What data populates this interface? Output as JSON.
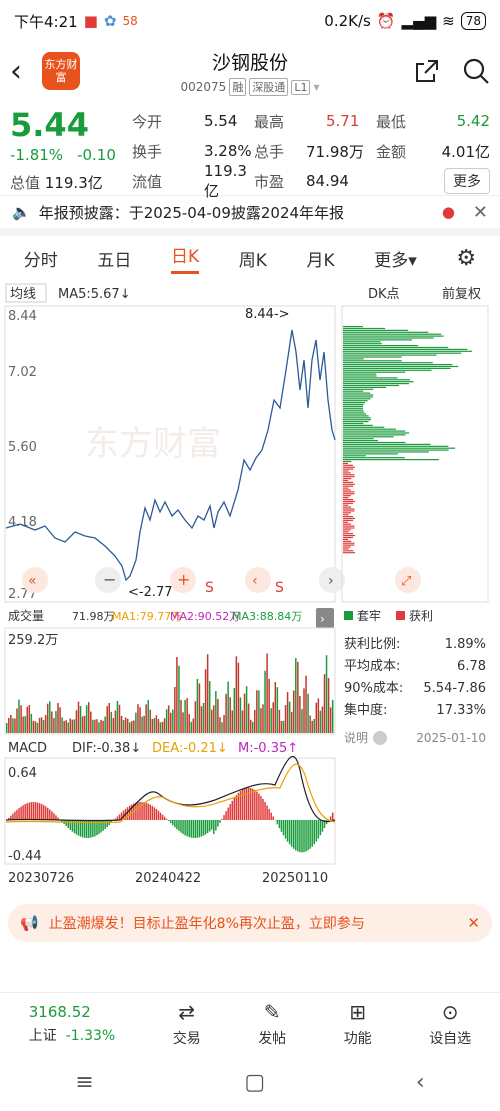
{
  "status": {
    "time": "下午4:21",
    "speed": "0.2K/s",
    "battery": "78",
    "app58": "58"
  },
  "header": {
    "logo": "东方财富",
    "title": "沙钢股份",
    "code": "002075",
    "tags": [
      "融",
      "深股通",
      "L1"
    ]
  },
  "quote": {
    "price": "5.44",
    "pct": "-1.81%",
    "chg": "-0.10",
    "rows": [
      [
        {
          "k": "今开",
          "v": "5.54",
          "c": ""
        },
        {
          "k": "最高",
          "v": "5.71",
          "c": "red"
        },
        {
          "k": "最低",
          "v": "5.42",
          "c": "green"
        }
      ],
      [
        {
          "k": "换手",
          "v": "3.28%",
          "c": ""
        },
        {
          "k": "总手",
          "v": "71.98万",
          "c": ""
        },
        {
          "k": "金额",
          "v": "4.01亿",
          "c": ""
        }
      ],
      [
        {
          "k": "总值",
          "v": "119.3亿",
          "c": ""
        },
        {
          "k": "流值",
          "v": "119.3亿",
          "c": ""
        },
        {
          "k": "市盈",
          "v": "84.94",
          "c": ""
        }
      ]
    ],
    "more": "更多"
  },
  "notice": {
    "text": "年报预披露：于2025-04-09披露2024年年报"
  },
  "tabs": [
    "分时",
    "五日",
    "日K",
    "周K",
    "月K",
    "更多"
  ],
  "chart": {
    "mode": "均线",
    "ma5": "MA5:5.67↓",
    "dk": "DK点",
    "fq": "前复权",
    "yticks": [
      "8.44",
      "7.02",
      "5.60",
      "4.18",
      "2.77"
    ],
    "high_label": "8.44->",
    "low_label": "<-2.77",
    "watermark": "东方财富",
    "vol_label": "成交量",
    "vol_val": "71.98万",
    "ma1": "MA1:79.77万",
    "ma2": "MA2:90.52万",
    "ma3": "MA3:88.84万",
    "vol_max": "259.2万",
    "macd": "MACD",
    "dif": "DIF:-0.38↓",
    "dea": "DEA:-0.21↓",
    "m": "M:-0.35↑",
    "macd_top": "0.64",
    "macd_bot": "-0.44",
    "dates": [
      "20230726",
      "20240422",
      "20250110"
    ]
  },
  "chips": {
    "legend": [
      "套牢",
      "获利"
    ],
    "rows": [
      {
        "k": "获利比例:",
        "v": "1.89%"
      },
      {
        "k": "平均成本:",
        "v": "6.78"
      },
      {
        "k": "90%成本:",
        "v": "5.54-7.86"
      },
      {
        "k": "集中度:",
        "v": "17.33%"
      }
    ],
    "note": "说明",
    "date": "2025-01-10"
  },
  "banner": {
    "text": "止盈潮爆发！目标止盈年化8%再次止盈，立即参与"
  },
  "bottom": {
    "index": "3168.52",
    "index_name": "上证",
    "index_pct": "-1.33%",
    "items": [
      "交易",
      "发帖",
      "功能",
      "设自选"
    ]
  }
}
